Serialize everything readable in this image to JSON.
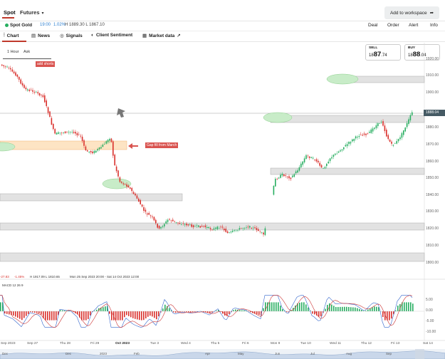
{
  "topbar": {
    "tabs": [
      "Spot",
      "Futures"
    ],
    "workspace_label": "Add to workspace"
  },
  "instrument": {
    "name": "Spot Gold",
    "time": "19:00",
    "change": "1.02%",
    "high_low": "H 1889.30 L 1867.10",
    "actions": [
      "Deal",
      "Order",
      "Alert",
      "Info"
    ]
  },
  "chart_tabs": [
    "Chart",
    "News",
    "Signals",
    "Client Sentiment",
    "Market data"
  ],
  "toolbar": {
    "timeframe": "1 Hour",
    "price_type": "Ask"
  },
  "sell": {
    "label": "SELL",
    "prefix": "18",
    "big": "87",
    "small": ".74"
  },
  "buy": {
    "label": "BUY",
    "prefix": "18",
    "big": "88",
    "small": ".04"
  },
  "current_price": "1888.04",
  "annotations": {
    "add_shorts": "add shorts",
    "gap_fill": "Gap fill from March"
  },
  "price_axis": [
    "1920.00",
    "1910.00",
    "1900.00",
    "1880.00",
    "1870.00",
    "1860.00",
    "1850.00",
    "1840.00",
    "1830.00",
    "1820.00",
    "1810.00",
    "1800.00"
  ],
  "info_line": {
    "change": "-27.83",
    "pct": "-1.45%",
    "hl": "H 1917.09  L 1810.65",
    "range": "Mon 25 Sep 2023 20:00 - Sat 14 Oct 2023 12:00"
  },
  "macd": {
    "label": "MACD  12  26  9",
    "axis": [
      "5.00",
      "0.00",
      "-5.00",
      "-10.00"
    ],
    "colors": {
      "macd_line": "#3366cc",
      "signal_line": "#cc3333",
      "hist_pos": "#27ae60",
      "hist_neg": "#d9302c"
    }
  },
  "x_axis": [
    "Sep 27",
    "Thu 28",
    "Fri 29",
    "Oct 2023",
    "Tue 3",
    "Wed 4",
    "Thu 5",
    "Fri 6",
    "Mon 9",
    "Tue 10",
    "Wed 11",
    "Thu 12",
    "Fri 13",
    "Sat 14"
  ],
  "navigator": [
    "Sep 2023",
    "Dec",
    "2023",
    "Feb",
    "Apr",
    "May",
    "Jun",
    "Jul",
    "Aug",
    "Sep"
  ],
  "colors": {
    "accent": "#c0392b",
    "up_candle": "#27ae60",
    "down_candle": "#d9302c",
    "zone_grey": "#e0e0e0",
    "zone_orange": "#fde4c4",
    "ellipse_green": "#c8ecc8"
  }
}
